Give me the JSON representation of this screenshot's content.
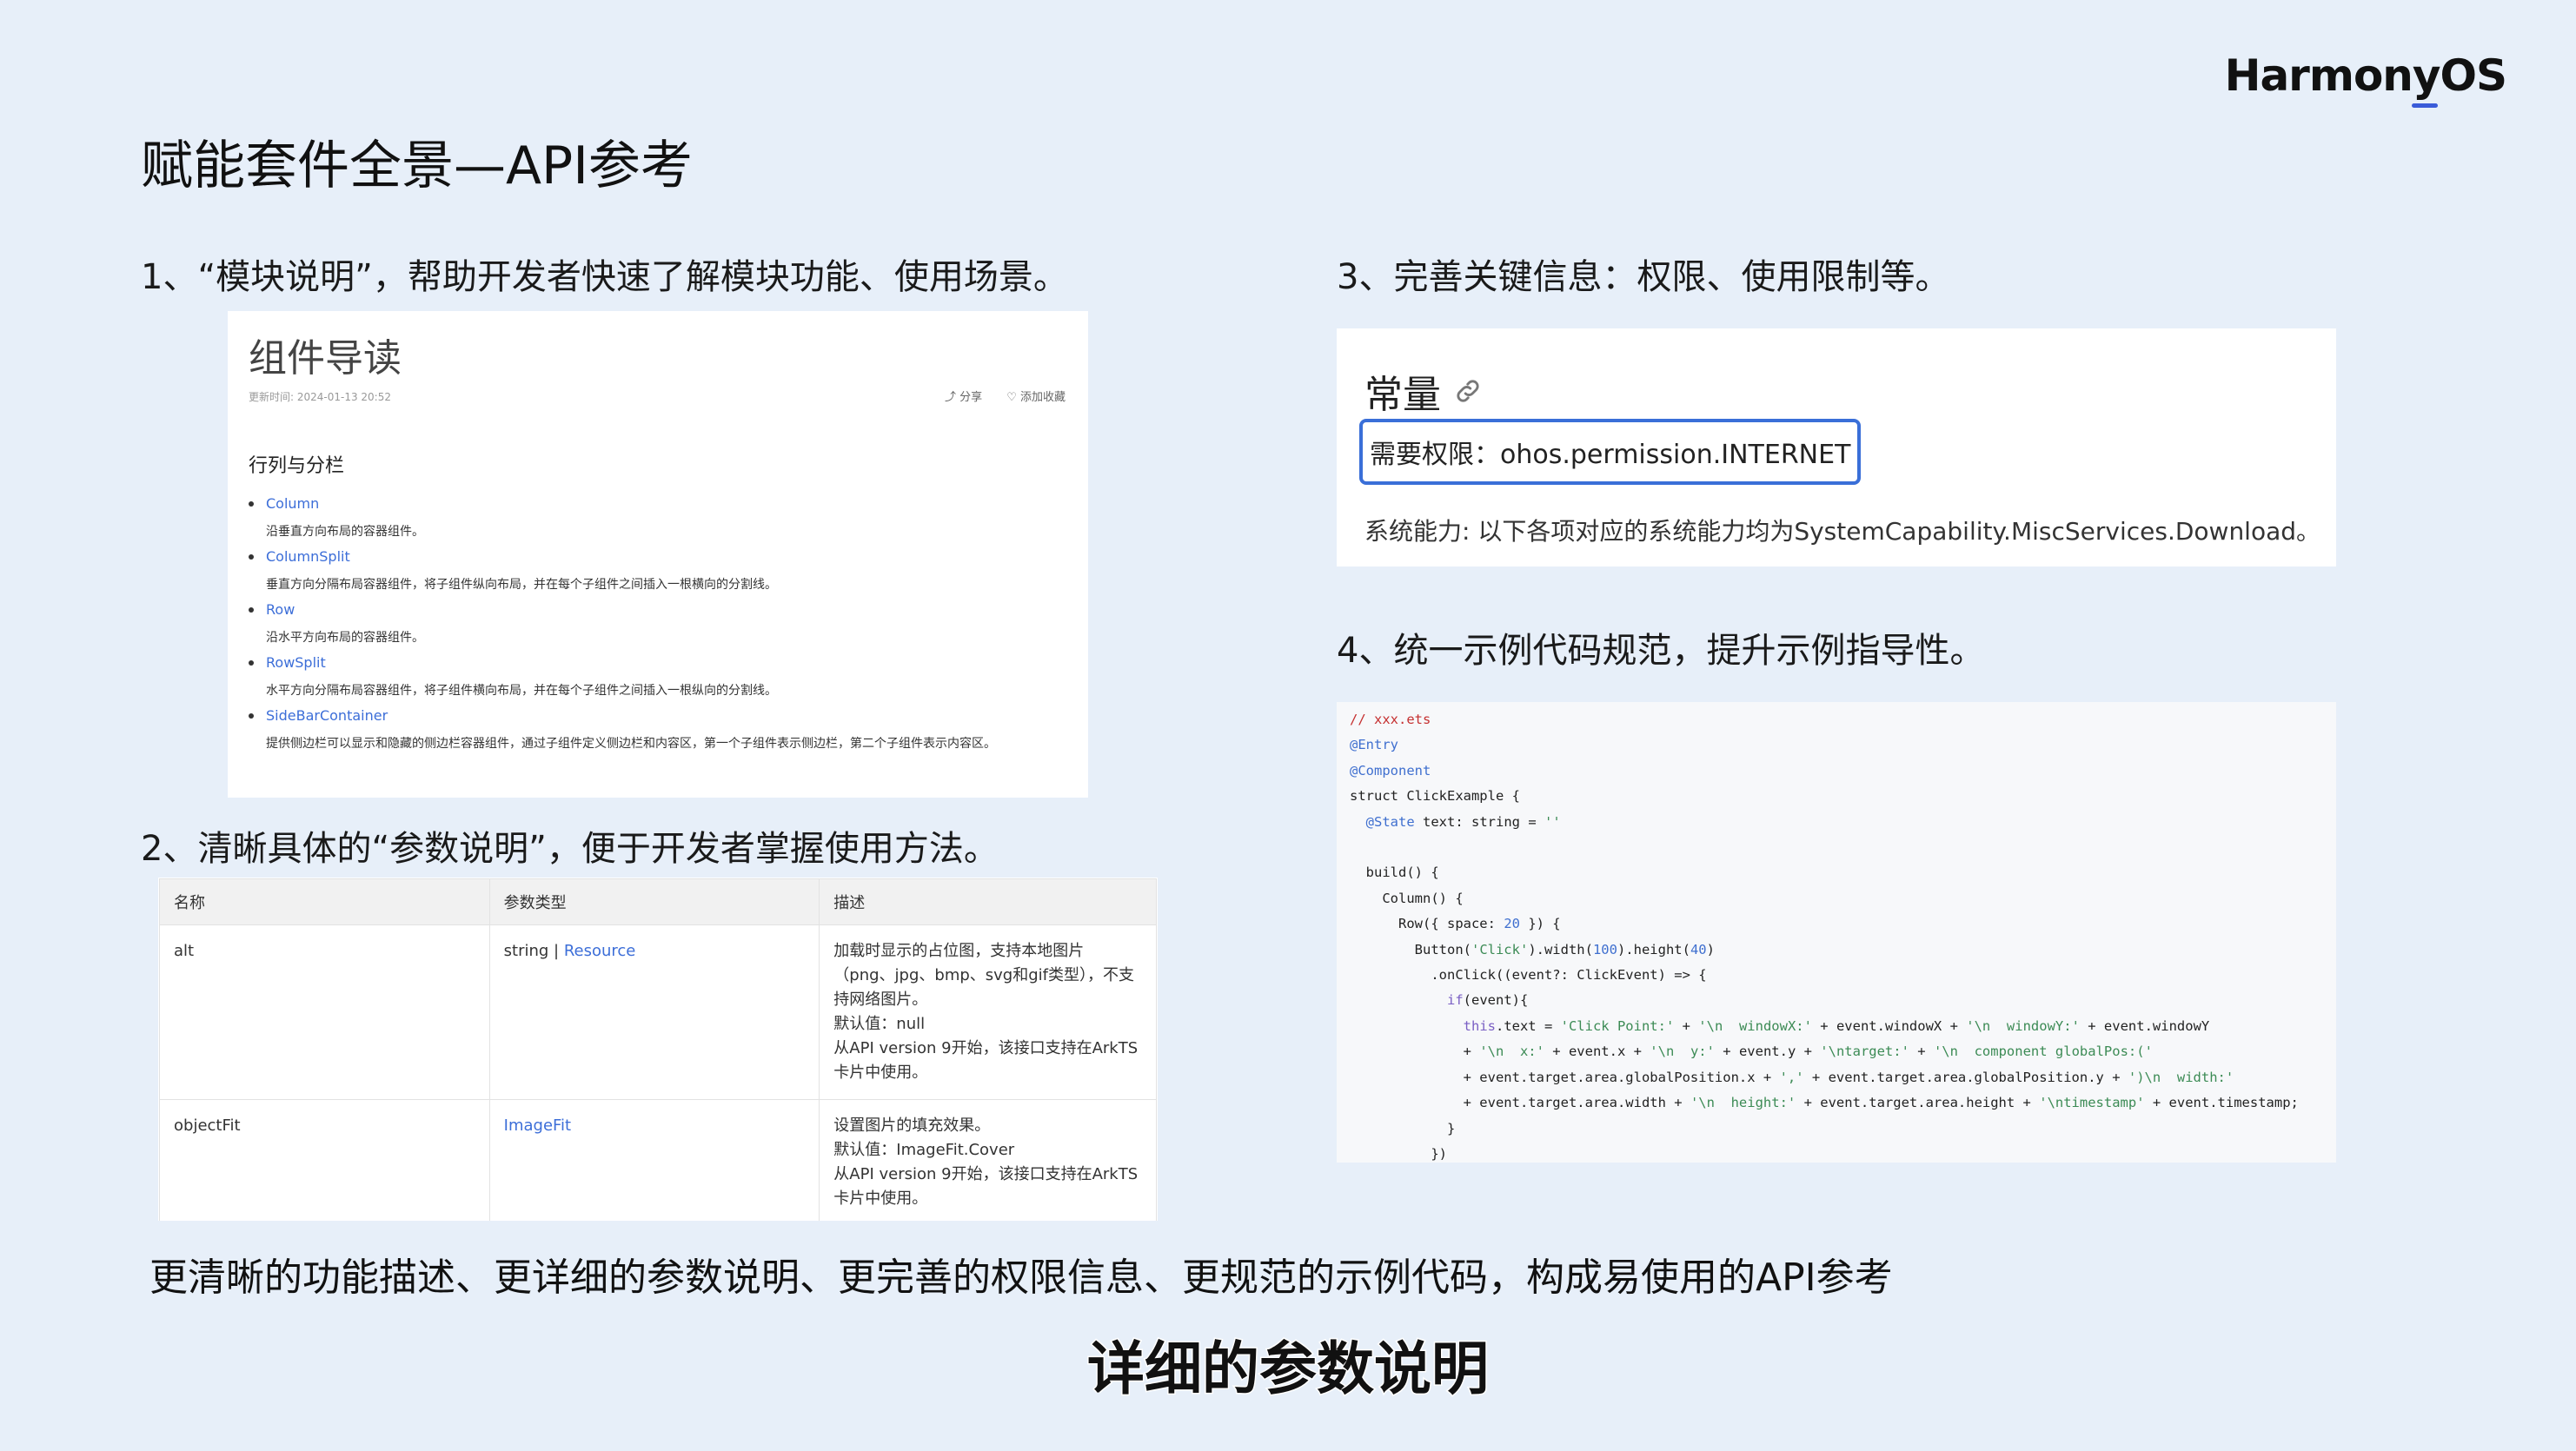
{
  "brand": {
    "logo_text": "HarmonyOS"
  },
  "slide": {
    "title": "赋能套件全景—API参考"
  },
  "sections": {
    "s1": "1、“模块说明”，帮助开发者快速了解模块功能、使用场景。",
    "s2": "2、清晰具体的“参数说明”，便于开发者掌握使用方法。",
    "s3": "3、完善关键信息：权限、使用限制等。",
    "s4": "4、统一示例代码规范，提升示例指导性。"
  },
  "guide": {
    "heading": "组件导读",
    "updated": "更新时间: 2024-01-13 20:52",
    "share": "分享",
    "favorite": "添加收藏",
    "subheading": "行列与分栏",
    "items": [
      {
        "name": "Column",
        "desc": "沿垂直方向布局的容器组件。"
      },
      {
        "name": "ColumnSplit",
        "desc": "垂直方向分隔布局容器组件，将子组件纵向布局，并在每个子组件之间插入一根横向的分割线。"
      },
      {
        "name": "Row",
        "desc": "沿水平方向布局的容器组件。"
      },
      {
        "name": "RowSplit",
        "desc": "水平方向分隔布局容器组件，将子组件横向布局，并在每个子组件之间插入一根纵向的分割线。"
      },
      {
        "name": "SideBarContainer",
        "desc": "提供侧边栏可以显示和隐藏的侧边栏容器组件，通过子组件定义侧边栏和内容区，第一个子组件表示侧边栏，第二个子组件表示内容区。"
      }
    ]
  },
  "params_table": {
    "headers": [
      "名称",
      "参数类型",
      "描述"
    ],
    "rows": [
      {
        "name": "alt",
        "type_prefix": "string | ",
        "type_link": "Resource",
        "desc": [
          "加载时显示的占位图，支持本地图片（png、jpg、bmp、svg和gif类型），不支持网络图片。",
          "默认值：null",
          "从API version 9开始，该接口支持在ArkTS卡片中使用。"
        ]
      },
      {
        "name": "objectFit",
        "type_prefix": "",
        "type_link": "ImageFit",
        "desc": [
          "设置图片的填充效果。",
          "默认值：ImageFit.Cover",
          "从API version 9开始，该接口支持在ArkTS卡片中使用。"
        ]
      }
    ]
  },
  "constants": {
    "heading": "常量",
    "permission": "需要权限：ohos.permission.INTERNET",
    "capability": "系统能力: 以下各项对应的系统能力均为SystemCapability.MiscServices.Download。"
  },
  "code_example": {
    "lines": [
      "// xxx.ets",
      "@Entry",
      "@Component",
      "struct ClickExample {",
      "  @State text: string = ''",
      "",
      "  build() {",
      "    Column() {",
      "      Row({ space: 20 }) {",
      "        Button('Click').width(100).height(40)",
      "          .onClick((event?: ClickEvent) => {",
      "            if(event){",
      "              this.text = 'Click Point:' + '\\n  windowX:' + event.windowX + '\\n  windowY:' + event.windowY",
      "              + '\\n  x:' + event.x + '\\n  y:' + event.y + '\\ntarget:' + '\\n  component globalPos:('",
      "              + event.target.area.globalPosition.x + ',' + event.target.area.globalPosition.y + ')\\n  width:'",
      "              + event.target.area.width + '\\n  height:' + event.target.area.height + '\\ntimestamp' + event.timestamp;",
      "            }",
      "          })"
    ]
  },
  "summary": "更清晰的功能描述、更详细的参数说明、更完善的权限信息、更规范的示例代码，构成易使用的API参考",
  "caption": "详细的参数说明",
  "colors": {
    "background": "#e7eff9",
    "link": "#3c6ed8",
    "highlight_border": "#3a6fd8"
  }
}
